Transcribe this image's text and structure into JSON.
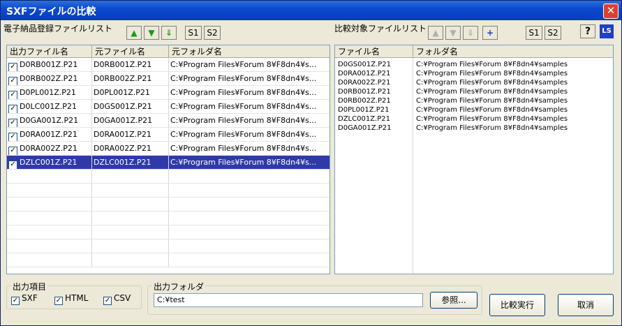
{
  "window": {
    "title": "SXFファイルの比較",
    "close": "✕"
  },
  "left": {
    "title": "電子納品登録ファイルリスト",
    "s1": "S1",
    "s2": "S2",
    "columns": [
      "出力ファイル名",
      "元ファイル名",
      "元フォルダ名"
    ],
    "rows": [
      {
        "checked": true,
        "out": "D0RB001Z.P21",
        "src": "D0RB001Z.P21",
        "folder": "C:¥Program Files¥Forum 8¥F8dn4¥s..."
      },
      {
        "checked": true,
        "out": "D0RB002Z.P21",
        "src": "D0RB002Z.P21",
        "folder": "C:¥Program Files¥Forum 8¥F8dn4¥s..."
      },
      {
        "checked": true,
        "out": "D0PL001Z.P21",
        "src": "D0PL001Z.P21",
        "folder": "C:¥Program Files¥Forum 8¥F8dn4¥s..."
      },
      {
        "checked": true,
        "out": "D0LC001Z.P21",
        "src": "D0GS001Z.P21",
        "folder": "C:¥Program Files¥Forum 8¥F8dn4¥s..."
      },
      {
        "checked": true,
        "out": "D0GA001Z.P21",
        "src": "D0GA001Z.P21",
        "folder": "C:¥Program Files¥Forum 8¥F8dn4¥s..."
      },
      {
        "checked": true,
        "out": "D0RA001Z.P21",
        "src": "D0RA001Z.P21",
        "folder": "C:¥Program Files¥Forum 8¥F8dn4¥s..."
      },
      {
        "checked": true,
        "out": "D0RA002Z.P21",
        "src": "D0RA002Z.P21",
        "folder": "C:¥Program Files¥Forum 8¥F8dn4¥s..."
      },
      {
        "checked": true,
        "out": "DZLC001Z.P21",
        "src": "DZLC001Z.P21",
        "folder": "C:¥Program Files¥Forum 8¥F8dn4¥s...",
        "selected": true
      }
    ]
  },
  "right": {
    "title": "比較対象ファイルリスト",
    "s1": "S1",
    "s2": "S2",
    "plus": "+",
    "columns": [
      "ファイル名",
      "フォルダ名"
    ],
    "rows": [
      {
        "file": "D0GS001Z.P21",
        "folder": "C:¥Program Files¥Forum 8¥F8dn4¥samples"
      },
      {
        "file": "D0RA001Z.P21",
        "folder": "C:¥Program Files¥Forum 8¥F8dn4¥samples"
      },
      {
        "file": "D0RA002Z.P21",
        "folder": "C:¥Program Files¥Forum 8¥F8dn4¥samples"
      },
      {
        "file": "D0RB001Z.P21",
        "folder": "C:¥Program Files¥Forum 8¥F8dn4¥samples"
      },
      {
        "file": "D0RB002Z.P21",
        "folder": "C:¥Program Files¥Forum 8¥F8dn4¥samples"
      },
      {
        "file": "D0PL001Z.P21",
        "folder": "C:¥Program Files¥Forum 8¥F8dn4¥samples"
      },
      {
        "file": "DZLC001Z.P21",
        "folder": "C:¥Program Files¥Forum 8¥F8dn4¥samples"
      },
      {
        "file": "D0GA001Z.P21",
        "folder": "C:¥Program Files¥Forum 8¥F8dn4¥samples"
      }
    ]
  },
  "output_items": {
    "title": "出力項目",
    "options": [
      {
        "label": "SXF",
        "checked": true
      },
      {
        "label": "HTML",
        "checked": true
      },
      {
        "label": "CSV",
        "checked": true
      }
    ]
  },
  "output_folder": {
    "title": "出力フォルダ",
    "value": "C:¥test",
    "browse": "参照..."
  },
  "buttons": {
    "compare": "比較実行",
    "cancel": "取消"
  },
  "icons": {
    "help": "?",
    "ls": "LS"
  }
}
